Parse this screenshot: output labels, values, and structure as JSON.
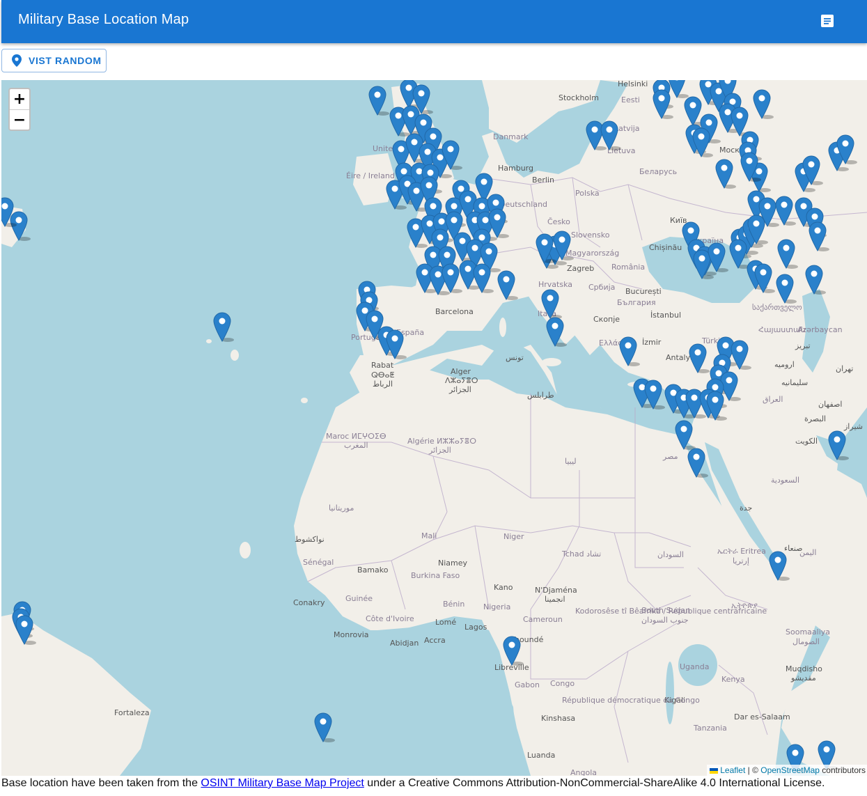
{
  "app": {
    "title": "Military Base Location Map",
    "menu_icon": "description-icon"
  },
  "toolbar": {
    "random_label": "VIST RANDOM",
    "random_icon": "location-pin-icon"
  },
  "map": {
    "zoom_in": "+",
    "zoom_out": "−",
    "colors": {
      "water": "#aad3df",
      "land": "#f2efe9",
      "marker": "#2a81cb"
    },
    "labels": [
      "Helsinki",
      "Stockholm",
      "Eesti",
      "Latvija",
      "Lietuva",
      "Danmark",
      "Москва",
      "United Kingdom",
      "Éire / Ireland",
      "Hamburg",
      "Berlin",
      "Беларусь",
      "Polska",
      "Deutschland",
      "Česko",
      "Slovensko",
      "Київ",
      "Україна",
      "Chișinău",
      "Magyarország",
      "Zagreb",
      "România",
      "Hrvatska",
      "Србија",
      "București",
      "България",
      "Barcelona",
      "Italia",
      "Скопје",
      "İstanbul",
      "España",
      "Portugal",
      "Ελλάς",
      "İzmir",
      "Türkiye",
      "Antalya",
      "საქართველო",
      "Հայաստան",
      "Azərbaycan",
      "تبریز",
      "ارومیه",
      "سلیمانیه",
      "تهران",
      "العراق",
      "اصفهان",
      "البصرة",
      "شیراز",
      "الكويت",
      "Rabat",
      "ⵕⴱⴰⵟ",
      "الرباط",
      "Alger",
      "ⴷⵣⴰⵢⴻⵔ",
      "الجزائر",
      "تونس",
      "طرابلس",
      "Maroc ⵍⵎⵖⵔⵉⴱ",
      "المغرب",
      "Algérie ⵍⵣⵣⴰⵢⴻⵔ",
      "الجزائر",
      "ليبيا",
      "مصر",
      "السعودية",
      "جدة",
      "موريتانيا",
      "نواكشوط",
      "Mali",
      "Niger",
      "Tchad تشاد",
      "السودان",
      "ኤርትራ Eritrea",
      "إرتريا",
      "صنعاء",
      "اليمن",
      "Sénégal",
      "Bamako",
      "Niamey",
      "Burkina Faso",
      "Kano",
      "N'Djaména",
      "انجمينا",
      "ኢትዮጵያ",
      "Conakry",
      "Guinée",
      "Bénin",
      "Nigeria",
      "Kodorosêse tî Bêafrîka / République centrafricaine",
      "South Sudan",
      "جنوب السودان",
      "Côte d'Ivoire",
      "Lomé",
      "Cameroun",
      "Lagos",
      "Monrovia",
      "Abidjan",
      "Accra",
      "Yaoundé",
      "Soomaaliya",
      "الصومال",
      "Libreville",
      "Uganda",
      "Muqdisho",
      "مقديشو",
      "Gabon",
      "Congo",
      "Kenya",
      "Fortaleza",
      "Kigali",
      "République démocratique du Congo",
      "Kinshasa",
      "Dar es-Salaam",
      "Tanzania",
      "Luanda",
      "Angola"
    ],
    "attribution": {
      "leaflet": "Leaflet",
      "separator": " | © ",
      "osm": "OpenStreetMap",
      "suffix": " contributors"
    }
  },
  "footer": {
    "prefix": "Base location have been taken from the ",
    "link_text": "OSINT Military Base Map Project",
    "suffix": " under a Creative Commons Attribution-NonCommercial-ShareAlike 4.0 International License."
  }
}
